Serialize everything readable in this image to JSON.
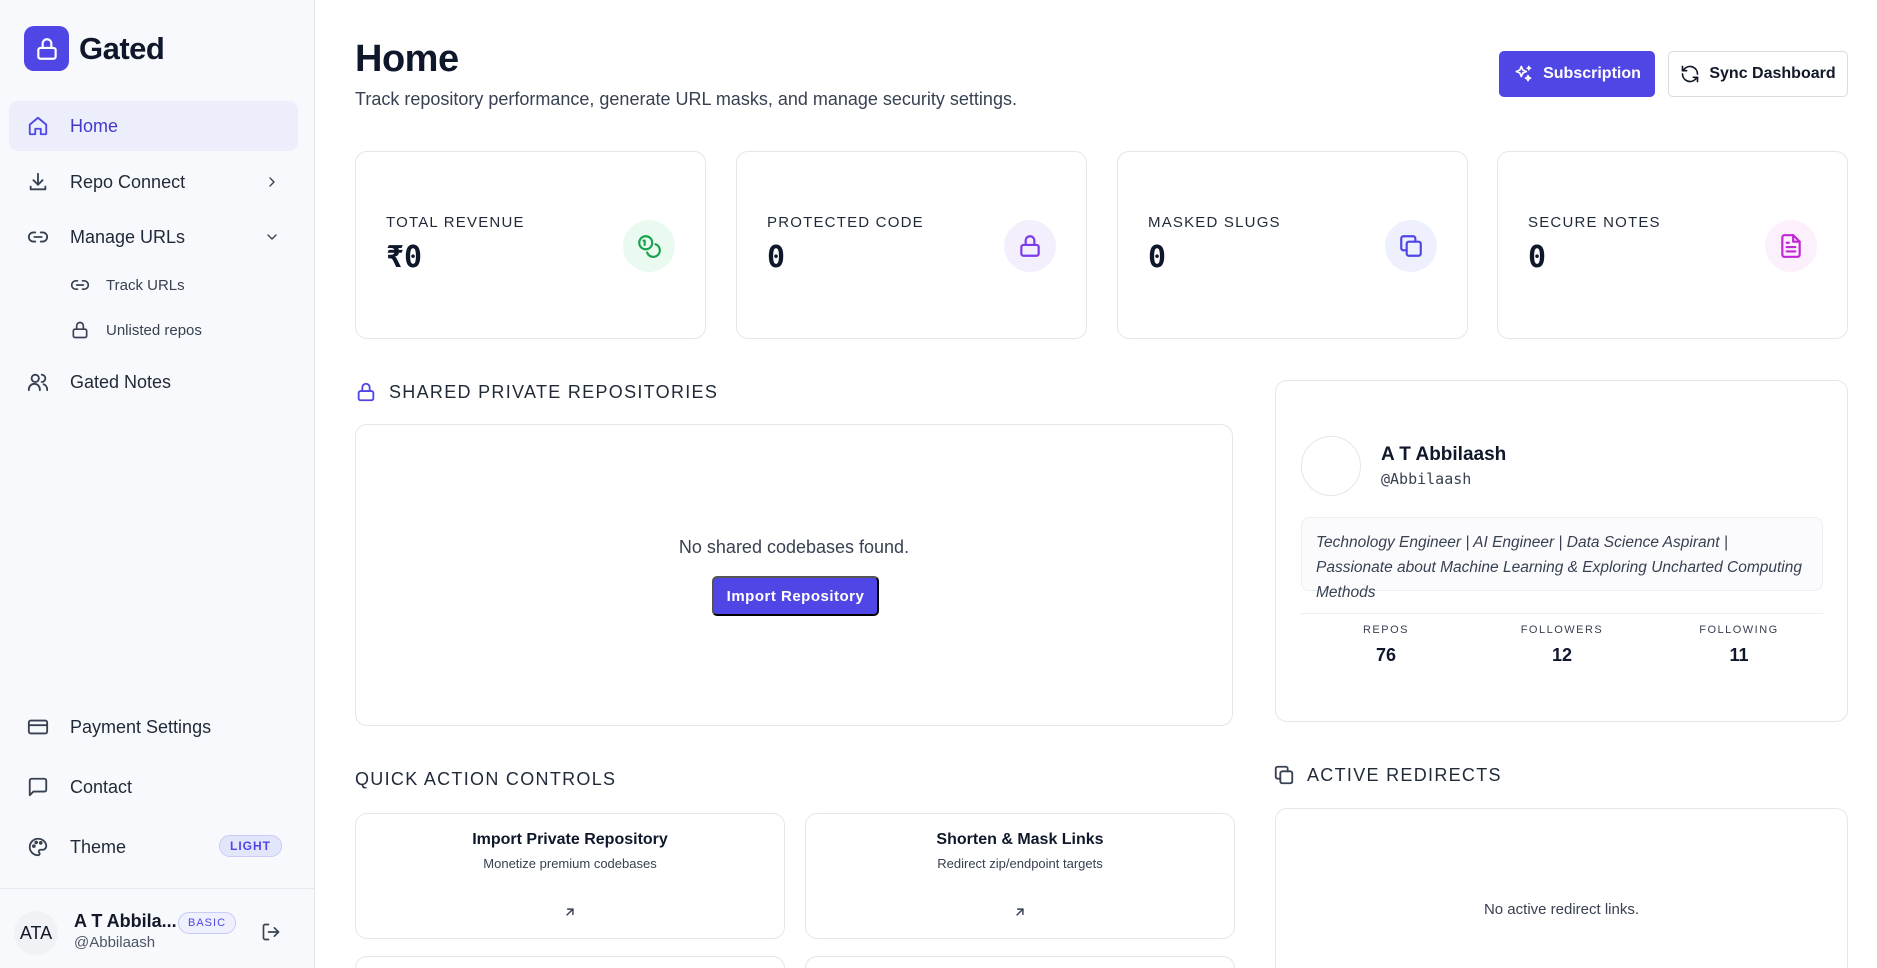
{
  "app": {
    "name": "Gated"
  },
  "sidebar": {
    "items": [
      {
        "label": "Home",
        "icon": "home-icon"
      },
      {
        "label": "Repo Connect",
        "icon": "download-icon"
      },
      {
        "label": "Manage URLs",
        "icon": "link-icon"
      },
      {
        "label": "Gated Notes",
        "icon": "users-icon"
      }
    ],
    "sub_items": [
      {
        "label": "Track URLs",
        "icon": "link-icon"
      },
      {
        "label": "Unlisted repos",
        "icon": "lock-icon"
      }
    ],
    "bottom_items": [
      {
        "label": "Payment Settings",
        "icon": "credit-card-icon"
      },
      {
        "label": "Contact",
        "icon": "message-square-icon"
      },
      {
        "label": "Theme",
        "icon": "palette-icon",
        "badge": "LIGHT"
      }
    ],
    "user": {
      "initials": "ATA",
      "name": "A T Abbila...",
      "handle": "@Abbilaash",
      "plan": "BASIC"
    }
  },
  "header": {
    "title": "Home",
    "subtitle": "Track repository performance, generate URL masks, and manage security settings.",
    "subscription_label": "Subscription",
    "sync_label": "Sync Dashboard"
  },
  "stats": [
    {
      "label": "TOTAL REVENUE",
      "value": "₹0",
      "icon": "coins-icon",
      "color": "#16a34a",
      "bg": "#eafaf0"
    },
    {
      "label": "PROTECTED CODE",
      "value": "0",
      "icon": "lock-icon",
      "color": "#7c3aed",
      "bg": "#f3effd"
    },
    {
      "label": "MASKED SLUGS",
      "value": "0",
      "icon": "copy-icon",
      "color": "#4f46e5",
      "bg": "#eef0fd"
    },
    {
      "label": "SECURE NOTES",
      "value": "0",
      "icon": "file-text-icon",
      "color": "#c026d3",
      "bg": "#fcf0fd"
    }
  ],
  "shared_repos": {
    "title": "SHARED PRIVATE REPOSITORIES",
    "empty": "No shared codebases found.",
    "import_label": "Import Repository"
  },
  "profile": {
    "name": "A T Abbilaash",
    "handle": "@Abbilaash",
    "bio": "Technology Engineer | AI Engineer | Data Science Aspirant | Passionate about Machine Learning & Exploring Uncharted Computing Methods",
    "stats": [
      {
        "label": "REPOS",
        "value": "76"
      },
      {
        "label": "FOLLOWERS",
        "value": "12"
      },
      {
        "label": "FOLLOWING",
        "value": "11"
      }
    ]
  },
  "quick_actions": {
    "title": "QUICK ACTION CONTROLS",
    "cards": [
      {
        "title": "Import Private Repository",
        "subtitle": "Monetize premium codebases"
      },
      {
        "title": "Shorten & Mask Links",
        "subtitle": "Redirect zip/endpoint targets"
      }
    ]
  },
  "redirects": {
    "title": "ACTIVE REDIRECTS",
    "empty": "No active redirect links."
  },
  "colors": {
    "accent": "#4f46e5",
    "sidebar_bg": "#f8f9fc",
    "border": "#e4e6ec"
  }
}
